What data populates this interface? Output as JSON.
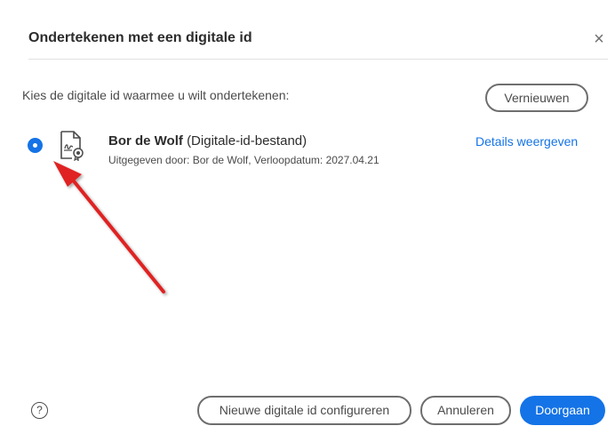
{
  "dialog": {
    "title": "Ondertekenen met een digitale id",
    "close_glyph": "×"
  },
  "prompt": "Kies de digitale id waarmee u wilt ondertekenen:",
  "refresh_label": "Vernieuwen",
  "digital_id": {
    "selected": true,
    "name": "Bor de Wolf",
    "type": "(Digitale-id-bestand)",
    "issuer_line": "Uitgegeven door: Bor de Wolf, Verloopdatum: 2027.04.21",
    "details_label": "Details weergeven",
    "icon": "certificate-file-icon"
  },
  "footer": {
    "help_glyph": "?",
    "configure_label": "Nieuwe digitale id configureren",
    "cancel_label": "Annuleren",
    "continue_label": "Doorgaan"
  },
  "colors": {
    "accent": "#1473e6",
    "annotation_arrow": "#e02020"
  }
}
